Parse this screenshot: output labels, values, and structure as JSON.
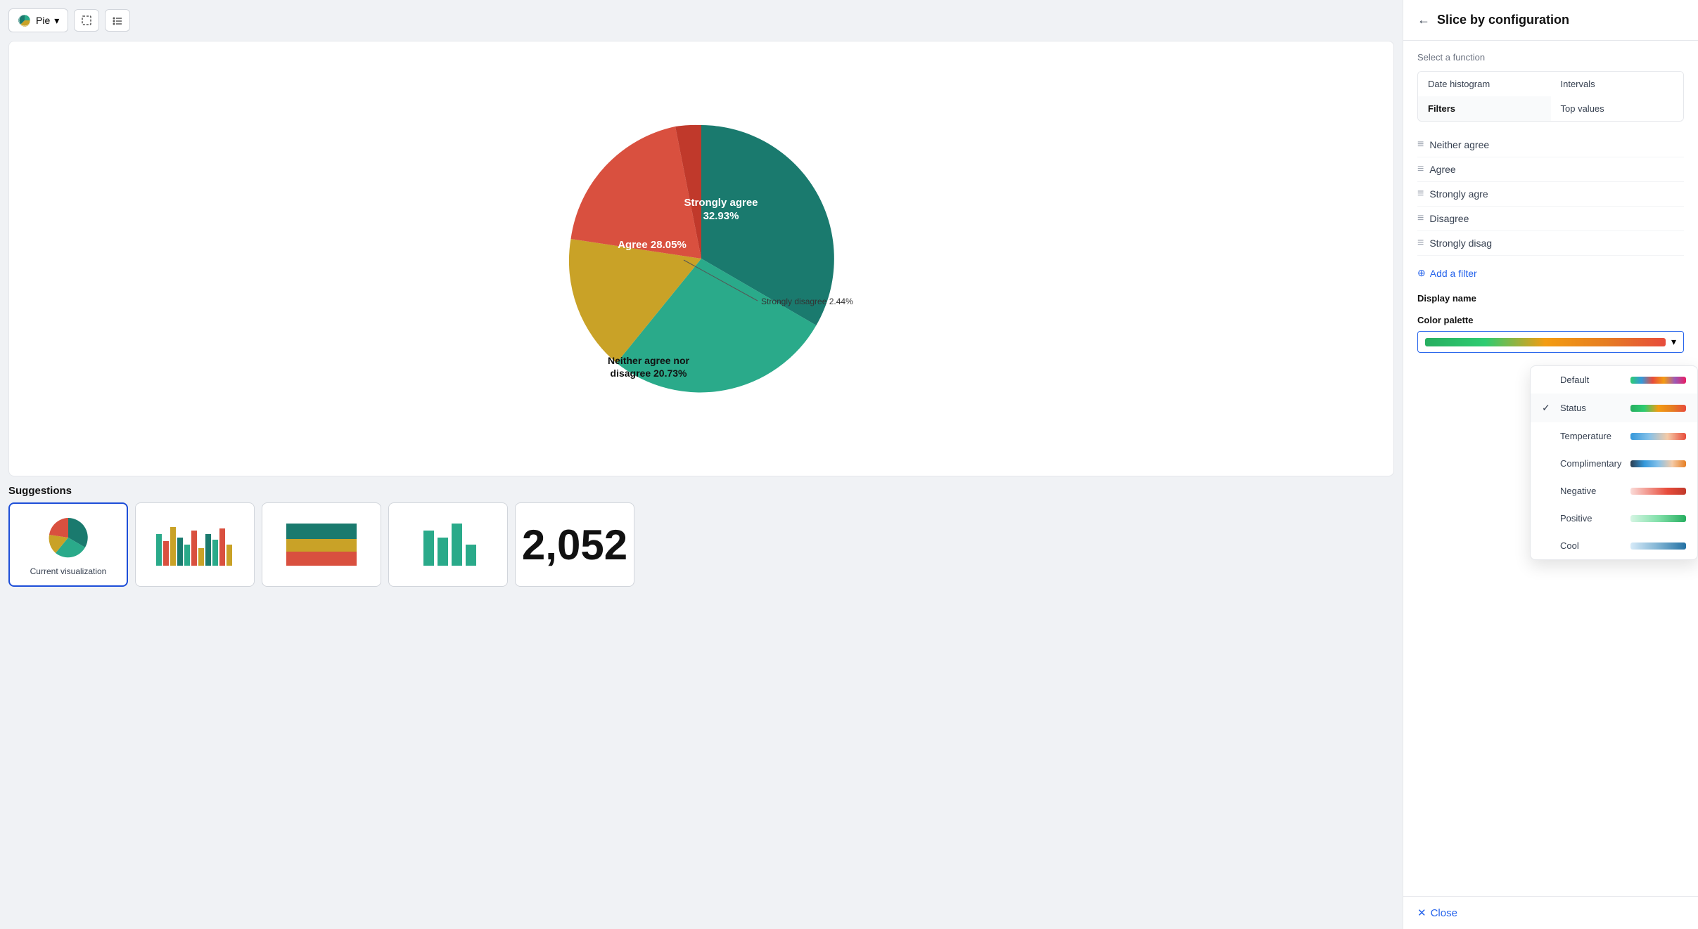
{
  "toolbar": {
    "chart_type": "Pie",
    "icon1": "select-icon",
    "icon2": "list-icon"
  },
  "pie_chart": {
    "segments": [
      {
        "label": "Strongly agree",
        "value": 32.93,
        "color": "#1a7a6e",
        "large": true
      },
      {
        "label": "Agree",
        "value": 28.05,
        "color": "#2aaa8a",
        "large": false
      },
      {
        "label": "Neither agree nor disagree",
        "value": 20.73,
        "color": "#c9a227",
        "large": false
      },
      {
        "label": "Disagree",
        "value": 15.85,
        "color": "#d9503f",
        "large": false
      },
      {
        "label": "Strongly disagree",
        "value": 2.44,
        "color": "#c0392b",
        "large": false
      }
    ]
  },
  "suggestions": {
    "title": "Suggestions",
    "items": [
      {
        "label": "Current visualization",
        "active": true
      },
      {
        "label": "",
        "active": false
      },
      {
        "label": "",
        "active": false
      },
      {
        "label": "",
        "active": false
      },
      {
        "label": "2,052",
        "active": false
      }
    ]
  },
  "right_panel": {
    "title": "Slice by configuration",
    "back_icon": "←",
    "select_function_label": "Select a function",
    "functions": [
      {
        "label": "Date histogram",
        "active": false
      },
      {
        "label": "Intervals",
        "active": false
      },
      {
        "label": "Filters",
        "active": true
      },
      {
        "label": "Top values",
        "active": false
      }
    ],
    "filters": [
      {
        "label": "Neither agree"
      },
      {
        "label": "Agree"
      },
      {
        "label": "Strongly agre"
      },
      {
        "label": "Disagree"
      },
      {
        "label": "Strongly disag"
      }
    ],
    "add_filter_label": "Add a filter",
    "display_name_label": "Display name",
    "color_palette_label": "Color palette",
    "dropdown": {
      "items": [
        {
          "name": "Default",
          "gradient": "linear-gradient(to right, #2ecc71, #3498db, #e74c3c, #f39c12, #9b59b6, #e91e63)",
          "selected": false
        },
        {
          "name": "Status",
          "gradient": "linear-gradient(to right, #27ae60, #2ecc71, #f39c12, #e67e22, #e74c3c)",
          "selected": true
        },
        {
          "name": "Temperature",
          "gradient": "linear-gradient(to right, #3498db, #85c1e9, #f5cba7, #e74c3c)",
          "selected": false
        },
        {
          "name": "Complimentary",
          "gradient": "linear-gradient(to right, #2c3e50, #3498db, #85c1e9, #f5cba7, #e67e22)",
          "selected": false
        },
        {
          "name": "Negative",
          "gradient": "linear-gradient(to right, #fadbd8, #f1948a, #e74c3c, #c0392b)",
          "selected": false
        },
        {
          "name": "Positive",
          "gradient": "linear-gradient(to right, #d5f5e3, #82e0aa, #27ae60)",
          "selected": false
        },
        {
          "name": "Cool",
          "gradient": "linear-gradient(to right, #d6eaf8, #7fb3d3, #2471a3)",
          "selected": false
        }
      ]
    },
    "selected_palette": "linear-gradient(to right, #27ae60, #2ecc71, #f39c12, #e67e22, #e74c3c)",
    "close_label": "Close"
  }
}
